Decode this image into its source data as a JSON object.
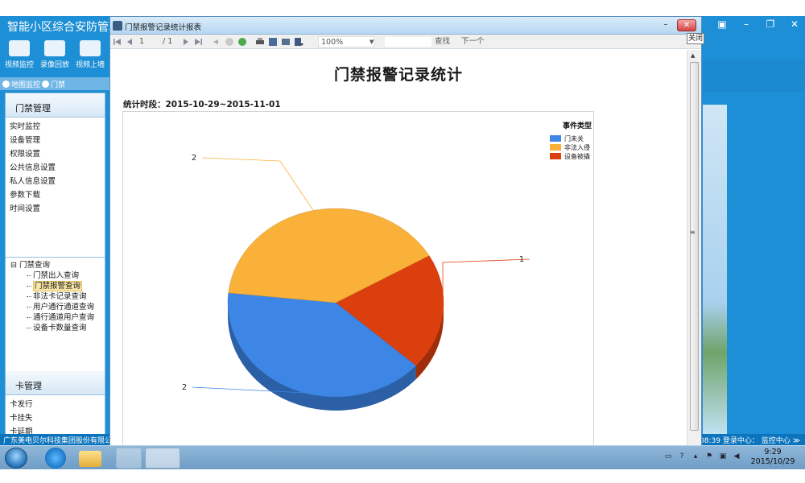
{
  "app": {
    "title": "智能小区综合安防管理",
    "controls": [
      "⇨",
      "▣",
      "–",
      "❐",
      "✕"
    ],
    "toolbar": [
      {
        "label": "视频监控",
        "icon": "camera-icon"
      },
      {
        "label": "录像回放",
        "icon": "video-play-icon"
      },
      {
        "label": "视频上墙",
        "icon": "video-wall-icon"
      }
    ],
    "tabs": [
      {
        "label": "地图监控",
        "icon": "map-icon"
      },
      {
        "label": "门禁",
        "icon": "door-icon"
      }
    ],
    "sidebar": {
      "section1_title": "门禁管理",
      "section1_items": [
        "实时监控",
        "设备管理",
        "权限设置",
        "公共信息设置",
        "私人信息设置",
        "参数下载",
        "时间设置"
      ],
      "tree_root": "门禁查询",
      "tree_items": [
        "门禁出入查询",
        "门禁报警查询",
        "非法卡记录查询",
        "用户通行通道查询",
        "通行通道用户查询",
        "设备卡数量查询"
      ],
      "tree_selected_index": 1,
      "section2_title": "卡管理",
      "section2_items": [
        "卡发行",
        "卡挂失",
        "卡延期"
      ]
    },
    "status_left": "广东美电贝尔科技集团股份有限公司",
    "status_right": "08:39  登录中心：  监控中心  ≫"
  },
  "report_window": {
    "title": "门禁报警记录统计报表",
    "close_label": "✕",
    "minimize_label": "–",
    "tooltip": "关闭",
    "toolbar": {
      "page_value": "1",
      "page_total": "/ 1",
      "zoom": "100%",
      "find_label": "查找",
      "next_label": "下一个"
    }
  },
  "report": {
    "title": "门禁报警记录统计",
    "period": "统计时段：2015-10-29~2015-11-01"
  },
  "chart_data": {
    "type": "pie",
    "legend_title": "事件类型",
    "legend_position": "top-right",
    "slices": [
      {
        "name": "门未关",
        "value": 2,
        "color": "#3d86e6",
        "label": "2"
      },
      {
        "name": "非法入侵",
        "value": 2,
        "color": "#f9b13a",
        "label": "2"
      },
      {
        "name": "设备被撬",
        "value": 1,
        "color": "#dc3f0e",
        "label": "1"
      }
    ]
  },
  "taskbar": {
    "time": "9:29",
    "date": "2015/10/29"
  }
}
